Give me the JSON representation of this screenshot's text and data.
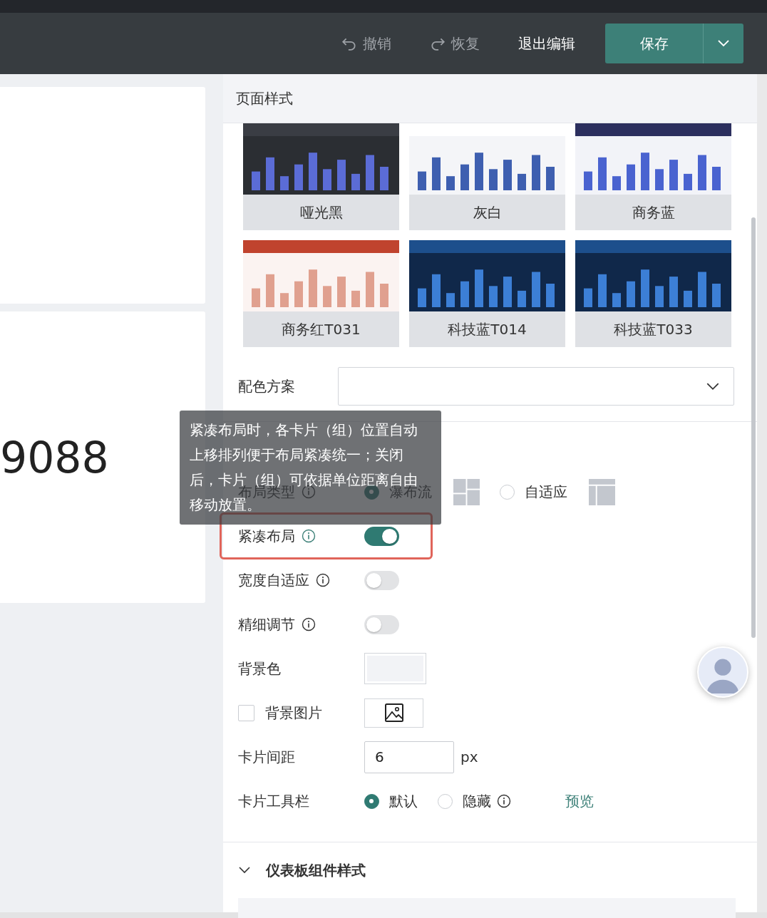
{
  "toolbar": {
    "undo": "撤销",
    "redo": "恢复",
    "exit": "退出编辑",
    "save": "保存"
  },
  "canvas": {
    "metric_value": "9088"
  },
  "panel": {
    "title": "页面样式",
    "themes": [
      {
        "name": "哑光黑",
        "kind": "dark"
      },
      {
        "name": "灰白",
        "kind": "light"
      },
      {
        "name": "商务蓝",
        "kind": "navy"
      },
      {
        "name": "商务红T031",
        "kind": "red"
      },
      {
        "name": "科技蓝T014",
        "kind": "tech"
      },
      {
        "name": "科技蓝T033",
        "kind": "tech"
      }
    ],
    "color_scheme": {
      "label": "配色方案"
    },
    "settings": [
      {
        "kind": "radio",
        "label": "布局类型",
        "info": true,
        "options": [
          {
            "label": "瀑布流",
            "selected": true,
            "info": false
          },
          {
            "label": "自适应",
            "selected": false,
            "info": false
          }
        ]
      },
      {
        "kind": "toggle",
        "label": "紧凑布局",
        "info": true,
        "on": true,
        "highlighted": true
      },
      {
        "kind": "toggle",
        "label": "宽度自适应",
        "info": true,
        "on": false,
        "highlighted": false
      },
      {
        "kind": "toggle",
        "label": "精细调节",
        "info": true,
        "on": false,
        "highlighted": false
      },
      {
        "kind": "color",
        "label": "背景色"
      },
      {
        "kind": "image",
        "label": "背景图片",
        "checked": false
      },
      {
        "kind": "number",
        "label": "卡片间距",
        "value": "6",
        "unit": "px"
      },
      {
        "kind": "choice",
        "label": "卡片工具栏",
        "options": [
          {
            "label": "默认",
            "selected": true,
            "info": false
          },
          {
            "label": "隐藏",
            "selected": false,
            "info": true
          }
        ],
        "link": "预览"
      }
    ],
    "section": {
      "title": "仪表板组件样式",
      "expanded": true
    }
  },
  "tooltip": "紧凑布局时，各卡片（组）位置自动上移排列便于布局紧凑统一；关闭后，卡片（组）可依据单位距离自由移动放置。"
}
